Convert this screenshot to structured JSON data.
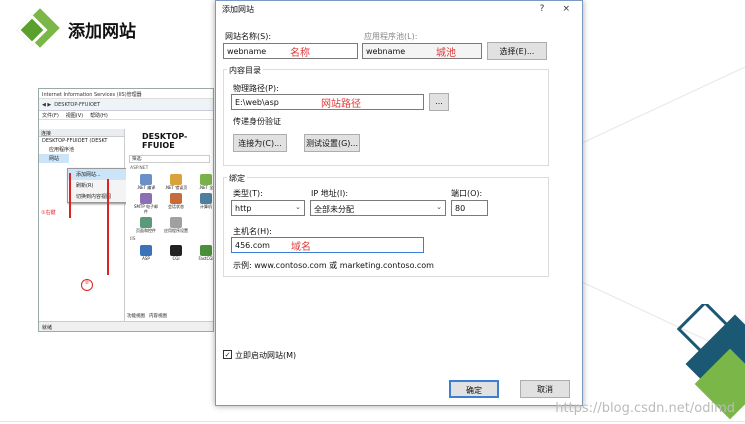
{
  "slide": {
    "title": "添加网站",
    "watermark": "https://blog.csdn.net/odimd"
  },
  "iis": {
    "window_title": "Internet Information Services (IIS)管理器",
    "address": "DESKTOP-FFUIOET",
    "menu": [
      "文件(F)",
      "视图(V)",
      "帮助(H)"
    ],
    "left_header": "连接",
    "tree": [
      "DESKTOP-FFUIOET (DESKT",
      "应用程序池",
      "网站"
    ],
    "context_menu": [
      "添加网站...",
      "刷新(R)",
      "切换到内容视图"
    ],
    "right_title": "DESKTOP-FFUIOE",
    "filter": "筛选:",
    "section1": "ASP.NET",
    "icons1": [
      ".NET 编译",
      ".NET 错误页",
      ".NET 全"
    ],
    "icons2": [
      "SMTP 电子邮件",
      "会话状态",
      "计算机"
    ],
    "icons3": [
      "页面和控件",
      "应用程序设置",
      ""
    ],
    "section2": "IIS",
    "icons4": [
      "ASP",
      "CGI",
      "FastCGI"
    ],
    "tabs": [
      "功能视图",
      "内容视图"
    ],
    "status": "就绪",
    "annotations": [
      "①右键",
      "②"
    ]
  },
  "dialog": {
    "title": "添加网站",
    "help": "?",
    "close": "×",
    "site_name_label": "网站名称(S):",
    "site_name_value": "webname",
    "site_name_note": "名称",
    "app_pool_label": "应用程序池(L):",
    "app_pool_value": "webname",
    "app_pool_note": "城池",
    "select_button": "选择(E)...",
    "content_dir_label": "内容目录",
    "physical_path_label": "物理路径(P):",
    "physical_path_value": "E:\\web\\asp",
    "physical_path_note": "网站路径",
    "browse_button": "...",
    "pass_auth_label": "传递身份验证",
    "connect_as_button": "连接为(C)...",
    "test_settings_button": "测试设置(G)...",
    "binding_label": "绑定",
    "type_label": "类型(T):",
    "type_value": "http",
    "ip_label": "IP 地址(I):",
    "ip_value": "全部未分配",
    "port_label": "端口(O):",
    "port_value": "80",
    "host_label": "主机名(H):",
    "host_value": "456.com",
    "host_note": "域名",
    "example_text": "示例: www.contoso.com 或 marketing.contoso.com",
    "start_checkbox_label": "立即启动网站(M)",
    "start_checked": true,
    "ok_button": "确定",
    "cancel_button": "取消"
  },
  "colors": {
    "accent_green": "#7ab648",
    "accent_blue": "#1a5873",
    "note_red": "#e03b3b"
  }
}
